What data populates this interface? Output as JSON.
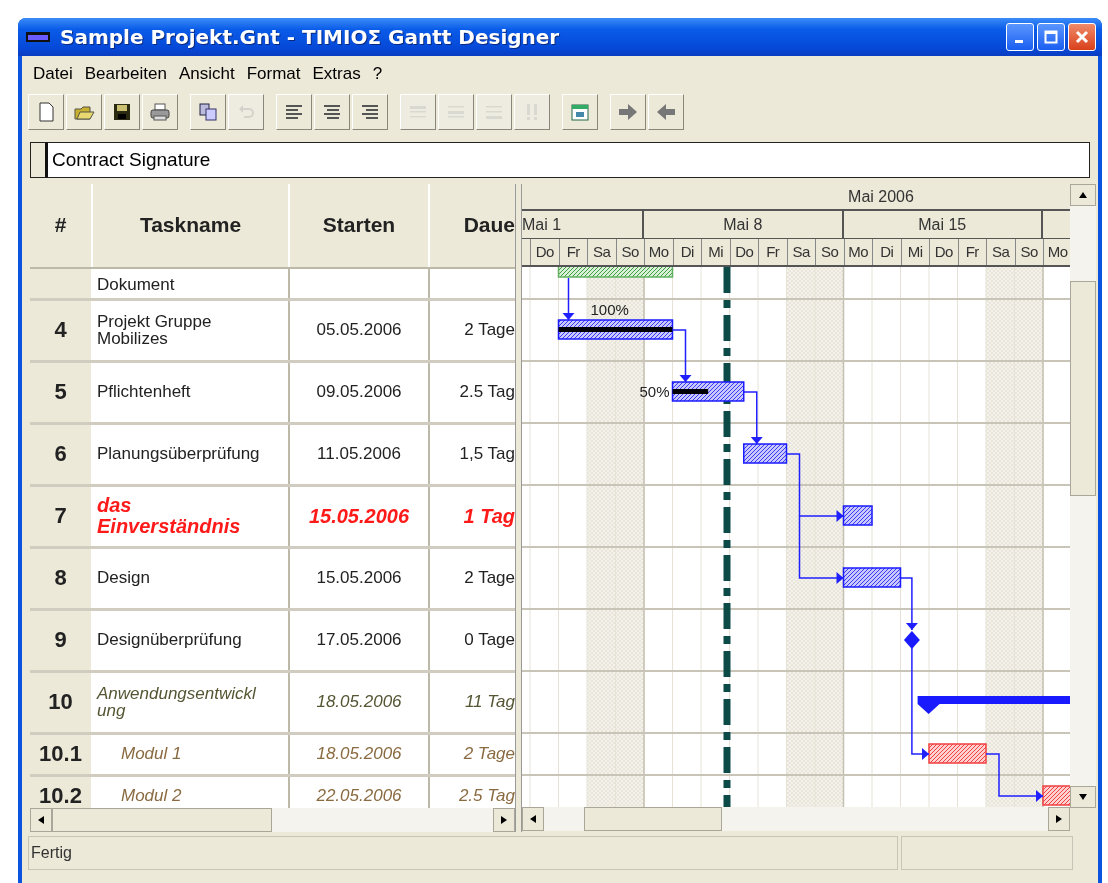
{
  "window": {
    "title": "Sample Projekt.Gnt - TIMIOΣ Gantt Designer"
  },
  "menu": [
    "Datei",
    "Bearbeiten",
    "Ansicht",
    "Format",
    "Extras",
    "?"
  ],
  "toolbar": [
    [
      {
        "kind": "new",
        "disabled": false
      },
      {
        "kind": "open",
        "disabled": false
      },
      {
        "kind": "save",
        "disabled": false
      },
      {
        "kind": "print",
        "disabled": false
      }
    ],
    [
      {
        "kind": "copy",
        "disabled": false
      },
      {
        "kind": "undo",
        "disabled": true
      }
    ],
    [
      {
        "kind": "align-left",
        "disabled": false
      },
      {
        "kind": "align-center",
        "disabled": false
      },
      {
        "kind": "align-right",
        "disabled": false
      }
    ],
    [
      {
        "kind": "lines-top",
        "disabled": true
      },
      {
        "kind": "lines-middle",
        "disabled": true
      },
      {
        "kind": "lines-bottom",
        "disabled": true
      },
      {
        "kind": "exclaim",
        "disabled": true
      }
    ],
    [
      {
        "kind": "calendar",
        "disabled": false
      }
    ],
    [
      {
        "kind": "arrow-right",
        "disabled": false
      },
      {
        "kind": "arrow-left",
        "disabled": false
      }
    ]
  ],
  "task_field": {
    "value": "Contract Signature"
  },
  "table": {
    "columns": [
      "#",
      "Taskname",
      "Starten",
      "Daue"
    ],
    "rows": [
      {
        "kind": "task",
        "name": "Dokument"
      },
      {
        "kind": "task",
        "number": "4",
        "name": "Projekt Gruppe\nMobilizes",
        "start": "05.05.2006",
        "duration": "2 Tage",
        "progress_label": "100%"
      },
      {
        "kind": "task",
        "number": "5",
        "name": "Pflichtenheft",
        "start": "09.05.2006",
        "duration": "2.5 Tag",
        "progress_label": "50%"
      },
      {
        "kind": "task",
        "number": "6",
        "name": "Planungsüberprüfung",
        "start": "11.05.2006",
        "duration": "1,5 Tag"
      },
      {
        "kind": "critical",
        "number": "7",
        "name": "das\nEinverständnis",
        "start": "15.05.2006",
        "duration": "1 Tag"
      },
      {
        "kind": "task",
        "number": "8",
        "name": "Design",
        "start": "15.05.2006",
        "duration": "2 Tage"
      },
      {
        "kind": "milestone",
        "number": "9",
        "name": "Designüberprüfung",
        "start": "17.05.2006",
        "duration": "0 Tage"
      },
      {
        "kind": "summary",
        "number": "10",
        "name": "Anwendungsentwickl\nung",
        "start": "18.05.2006",
        "duration": "11 Tag"
      },
      {
        "kind": "subtask",
        "number": "10.1",
        "name": "Modul 1",
        "start": "18.05.2006",
        "duration": "2 Tage"
      },
      {
        "kind": "subtask",
        "number": "10.2",
        "name": "Modul 2",
        "start": "22.05.2006",
        "duration": "2.5 Tag"
      }
    ]
  },
  "gantt": {
    "month": "Mai 2006",
    "weeks": [
      "Mai 1",
      "Mai 8",
      "Mai 15"
    ],
    "days": [
      "Do",
      "Fr",
      "Sa",
      "So",
      "Mo",
      "Di",
      "Mi",
      "Do",
      "Fr",
      "Sa",
      "So",
      "Mo",
      "Di",
      "Mi",
      "Do",
      "Fr",
      "Sa",
      "So",
      "Mo"
    ]
  },
  "status_bar": {
    "text": "Fertig"
  }
}
